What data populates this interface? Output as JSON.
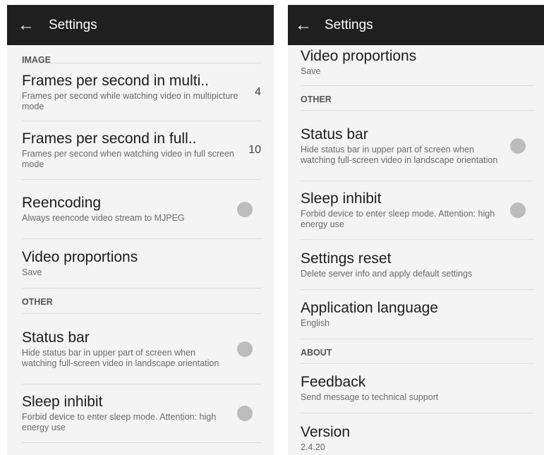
{
  "left": {
    "appbar_title": "Settings",
    "image_header": "IMAGE",
    "fps_multi": {
      "title": "Frames per second in multi..",
      "subtitle": "Frames per second while watching video in multipicture mode",
      "value": "4"
    },
    "fps_full": {
      "title": "Frames per second in full..",
      "subtitle": "Frames per second when watching video in full screen mode",
      "value": "10"
    },
    "reencoding": {
      "title": "Reencoding",
      "subtitle": "Always reencode video stream to MJPEG",
      "toggle": false
    },
    "video_proportions": {
      "title": "Video proportions",
      "subtitle": "Save"
    },
    "other_header": "OTHER",
    "status_bar": {
      "title": "Status bar",
      "subtitle": "Hide status bar in upper part of screen when watching full-screen video in landscape orientation",
      "toggle": false
    },
    "sleep_inhibit": {
      "title": "Sleep inhibit",
      "subtitle": "Forbid device to enter sleep mode. Attention: high energy use",
      "toggle": false
    }
  },
  "right": {
    "appbar_title": "Settings",
    "video_proportions": {
      "title": "Video proportions",
      "subtitle": "Save"
    },
    "other_header": "OTHER",
    "status_bar": {
      "title": "Status bar",
      "subtitle": "Hide status bar in upper part of screen when watching full-screen video in landscape orientation",
      "toggle": false
    },
    "sleep_inhibit": {
      "title": "Sleep inhibit",
      "subtitle": "Forbid device to enter sleep mode. Attention: high energy use",
      "toggle": false
    },
    "settings_reset": {
      "title": "Settings reset",
      "subtitle": "Delete server info and apply default settings"
    },
    "app_language": {
      "title": "Application language",
      "subtitle": "English"
    },
    "about_header": "ABOUT",
    "feedback": {
      "title": "Feedback",
      "subtitle": "Send message to technical support"
    },
    "version": {
      "title": "Version",
      "subtitle": "2.4.20"
    }
  },
  "icons": {
    "back": "arrow-left-icon",
    "toggle": "toggle-switch-off"
  },
  "colors": {
    "appbar": "#1f1f1f",
    "background": "#f4f4f4",
    "toggle_off": "#bcbcbc"
  }
}
